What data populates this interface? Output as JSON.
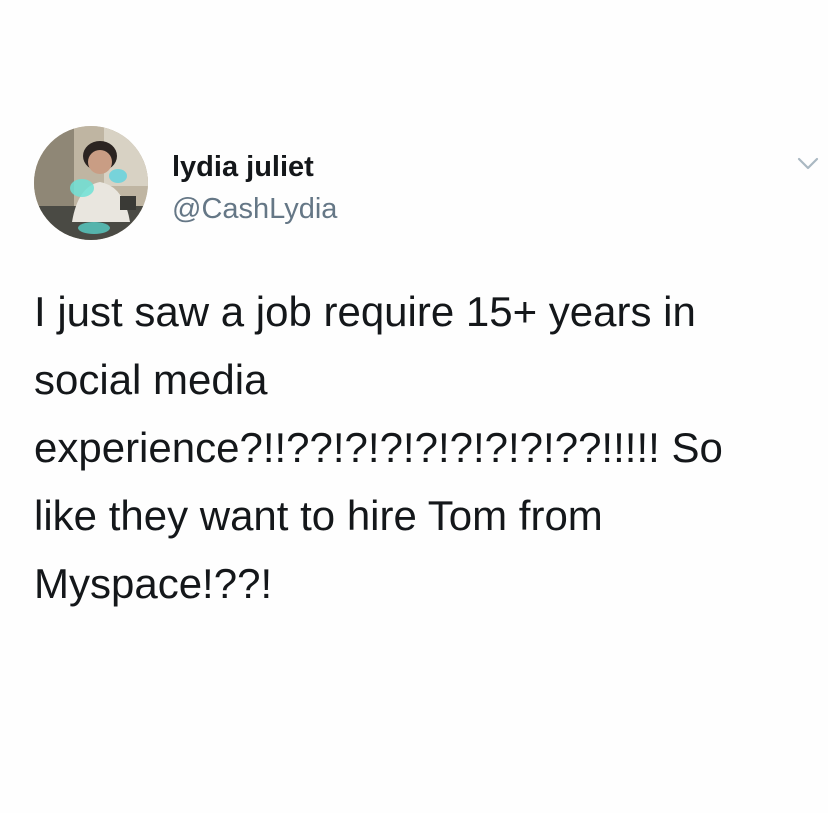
{
  "tweet": {
    "author": {
      "display_name": "lydia juliet",
      "handle": "@CashLydia"
    },
    "text_lines": [
      "I just saw a job require 15+ years in",
      "social media",
      "experience?!!??!?!?!?!?!?!?!??!!!!! So",
      "like they want to hire Tom from",
      "Myspace!??!"
    ],
    "menu_icon": "chevron-down-icon",
    "colors": {
      "text": "#14171a",
      "secondary": "#657786",
      "chevron": "#aab8c2",
      "background": "#ffffff"
    }
  }
}
